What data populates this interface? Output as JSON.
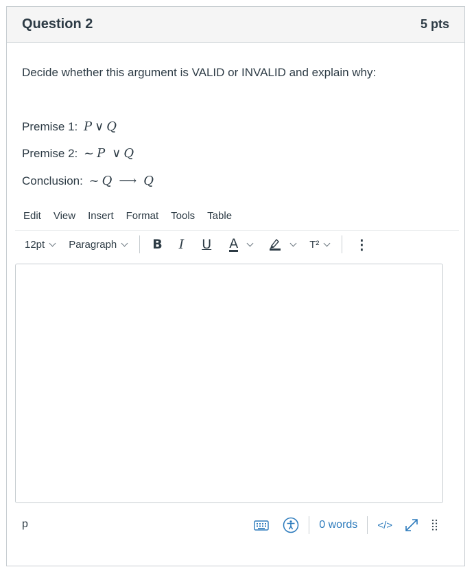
{
  "question": {
    "title": "Question 2",
    "points": "5 pts",
    "prompt": "Decide whether this argument is VALID or INVALID and explain why:",
    "premise1": {
      "label": "Premise 1:",
      "a": "P",
      "op": "∨",
      "b": "Q"
    },
    "premise2": {
      "label": "Premise 2:",
      "neg": "~",
      "a": "P",
      "op": "∨",
      "b": "Q"
    },
    "conclusion": {
      "label": "Conclusion:",
      "neg": "~",
      "a": "Q",
      "op": "⟶",
      "b": "Q"
    }
  },
  "menu": [
    "Edit",
    "View",
    "Insert",
    "Format",
    "Tools",
    "Table"
  ],
  "toolbar": {
    "font_size": "12pt",
    "block_format": "Paragraph",
    "bold": "B",
    "italic": "I",
    "underline": "U",
    "text_color": "A",
    "superscript": "T²",
    "more": "⋮"
  },
  "status": {
    "path": "p",
    "word_count": "0 words",
    "html_toggle": "</>"
  },
  "colors": {
    "accent": "#2b7abc",
    "text": "#2d3b45",
    "border": "#c7cdd1",
    "header_bg": "#f5f5f5"
  },
  "icons": [
    "keyboard-icon",
    "accessibility-icon",
    "fullscreen-icon",
    "resize-grip-icon",
    "chevron-down-icon",
    "highlight-icon"
  ]
}
